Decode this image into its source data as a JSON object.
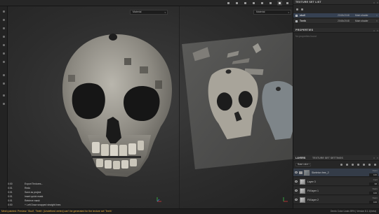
{
  "app": {
    "topbar_icons": [
      "screenshot-icon",
      "display-icon",
      "camera-icon",
      "light-icon",
      "grid-icon",
      "material-view-icon",
      "split-view-icon",
      "uv-view-icon"
    ]
  },
  "viewport": {
    "left_mode": "Material",
    "right_mode": "Material"
  },
  "log": [
    {
      "time": "0:00",
      "message": "Export Textures..."
    },
    {
      "time": "0:01",
      "message": "Redo"
    },
    {
      "time": "0:01",
      "message": "Save as project"
    },
    {
      "time": "0:01",
      "message": "Insert quick mask"
    },
    {
      "time": "0:01",
      "message": "Retrieve mask"
    },
    {
      "time": "0:00",
      "message": "+ Left Draw snapped straight lines"
    }
  ],
  "status": {
    "warning": "Mesh painted: Preview: 'Skull', 'Teeth': [Undefined vertex] can't be generated for the texture set 'Teeth'",
    "right": "Dento Color Liusis   89% | Version 8.1.1(beta)"
  },
  "panels": {
    "texture_set_list": {
      "title": "TEXTURE SET LIST",
      "rows": [
        {
          "name": "skull",
          "resolution": "2048x2048",
          "shader": "Main shader"
        },
        {
          "name": "Teeth",
          "resolution": "2048x2048",
          "shader": "Main shader"
        }
      ]
    },
    "properties": {
      "title": "PROPERTIES",
      "empty_text": "No properties found"
    },
    "layers": {
      "tab_layers": "LAYERS",
      "tab_settings": "TEXTURE SET SETTINGS",
      "blend_mode": "Base color",
      "rows": [
        {
          "name": "Skeleton free_2",
          "mode": "Norm",
          "opacity": "100",
          "type": "folder"
        },
        {
          "name": "Layer 3",
          "mode": "Cent",
          "opacity": "68",
          "type": "fill"
        },
        {
          "name": "Fill layer 1",
          "mode": "Norm",
          "opacity": "100",
          "type": "fill"
        },
        {
          "name": "Fill layer 2",
          "mode": "Norm",
          "opacity": "100",
          "type": "fill"
        }
      ]
    }
  },
  "colors": {
    "accent": "#364152",
    "warning": "#e8b040",
    "axis_x": "#d33a3a",
    "axis_y": "#3bbf4a",
    "axis_z": "#3b6fd6"
  }
}
